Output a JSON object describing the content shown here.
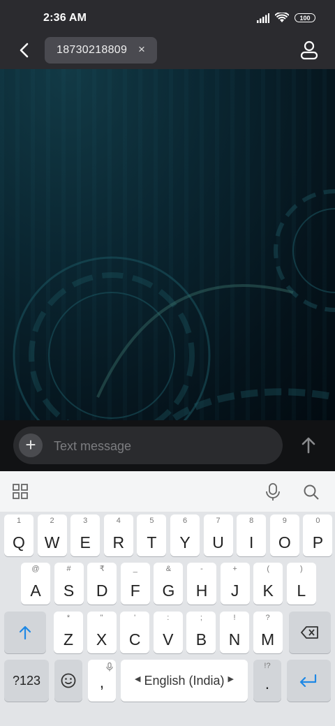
{
  "status_bar": {
    "time": "2:36 AM",
    "battery": "100"
  },
  "header": {
    "recipient": "18730218809",
    "chip_close": "×"
  },
  "compose": {
    "placeholder": "Text message",
    "plus": "+"
  },
  "keyboard": {
    "row1": [
      {
        "sub": "1",
        "label": "Q"
      },
      {
        "sub": "2",
        "label": "W"
      },
      {
        "sub": "3",
        "label": "E"
      },
      {
        "sub": "4",
        "label": "R"
      },
      {
        "sub": "5",
        "label": "T"
      },
      {
        "sub": "6",
        "label": "Y"
      },
      {
        "sub": "7",
        "label": "U"
      },
      {
        "sub": "8",
        "label": "I"
      },
      {
        "sub": "9",
        "label": "O"
      },
      {
        "sub": "0",
        "label": "P"
      }
    ],
    "row2": [
      {
        "sub": "@",
        "label": "A"
      },
      {
        "sub": "#",
        "label": "S"
      },
      {
        "sub": "₹",
        "label": "D"
      },
      {
        "sub": "_",
        "label": "F"
      },
      {
        "sub": "&",
        "label": "G"
      },
      {
        "sub": "-",
        "label": "H"
      },
      {
        "sub": "+",
        "label": "J"
      },
      {
        "sub": "(",
        "label": "K"
      },
      {
        "sub": ")",
        "label": "L"
      }
    ],
    "row3": [
      {
        "sub": "*",
        "label": "Z"
      },
      {
        "sub": "\"",
        "label": "X"
      },
      {
        "sub": "'",
        "label": "C"
      },
      {
        "sub": ":",
        "label": "V"
      },
      {
        "sub": ";",
        "label": "B"
      },
      {
        "sub": "!",
        "label": "N"
      },
      {
        "sub": "?",
        "label": "M"
      }
    ],
    "symbols_label": "?123",
    "comma_label": ",",
    "space_label": "English (India)",
    "period_label": ".",
    "period_sub": "!?"
  },
  "colors": {
    "accent": "#1e88e5",
    "header_bg": "#2b2b2f",
    "keyboard_bg": "#e2e4e7"
  }
}
